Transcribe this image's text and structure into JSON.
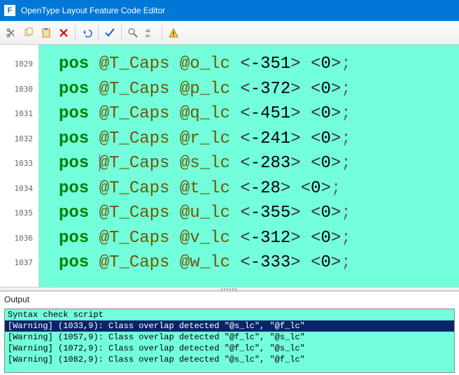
{
  "window": {
    "title": "OpenType Layout Feature Code Editor"
  },
  "toolbar": {
    "cut": "cut-icon",
    "copy": "copy-icon",
    "paste": "paste-icon",
    "delete": "delete-icon",
    "undo": "undo-icon",
    "check": "check-icon",
    "find": "find-icon",
    "replace": "replace-icon",
    "warn": "warning-icon"
  },
  "code": {
    "first_line_no": 1029,
    "lines": [
      {
        "n": 1029,
        "kw": "pos",
        "c1": "@T_Caps",
        "c2": "@o_lc",
        "v1": "-351",
        "v2": "0"
      },
      {
        "n": 1030,
        "kw": "pos",
        "c1": "@T_Caps",
        "c2": "@p_lc",
        "v1": "-372",
        "v2": "0"
      },
      {
        "n": 1031,
        "kw": "pos",
        "c1": "@T_Caps",
        "c2": "@q_lc",
        "v1": "-451",
        "v2": "0"
      },
      {
        "n": 1032,
        "kw": "pos",
        "c1": "@T_Caps",
        "c2": "@r_lc",
        "v1": "-241",
        "v2": "0"
      },
      {
        "n": 1033,
        "kw": "pos",
        "c1": "@T_Caps",
        "c2": "@s_lc",
        "v1": "-283",
        "v2": "0",
        "cursor_before_c1": true
      },
      {
        "n": 1034,
        "kw": "pos",
        "c1": "@T_Caps",
        "c2": "@t_lc",
        "v1": "-28",
        "v2": "0"
      },
      {
        "n": 1035,
        "kw": "pos",
        "c1": "@T_Caps",
        "c2": "@u_lc",
        "v1": "-355",
        "v2": "0"
      },
      {
        "n": 1036,
        "kw": "pos",
        "c1": "@T_Caps",
        "c2": "@v_lc",
        "v1": "-312",
        "v2": "0"
      },
      {
        "n": 1037,
        "kw": "pos",
        "c1": "@T_Caps",
        "c2": "@w_lc",
        "v1": "-333",
        "v2": "0"
      }
    ]
  },
  "output": {
    "label": "Output",
    "header": "Syntax check script",
    "rows": [
      {
        "selected": true,
        "text": "[Warning] (1033,9): Class overlap detected \"@s_lc\", \"@f_lc\""
      },
      {
        "selected": false,
        "text": "[Warning] (1057,9): Class overlap detected \"@f_lc\", \"@s_lc\""
      },
      {
        "selected": false,
        "text": "[Warning] (1072,9): Class overlap detected \"@f_lc\", \"@s_lc\""
      },
      {
        "selected": false,
        "text": "[Warning] (1082,9): Class overlap detected \"@s_lc\", \"@f_lc\""
      }
    ]
  }
}
